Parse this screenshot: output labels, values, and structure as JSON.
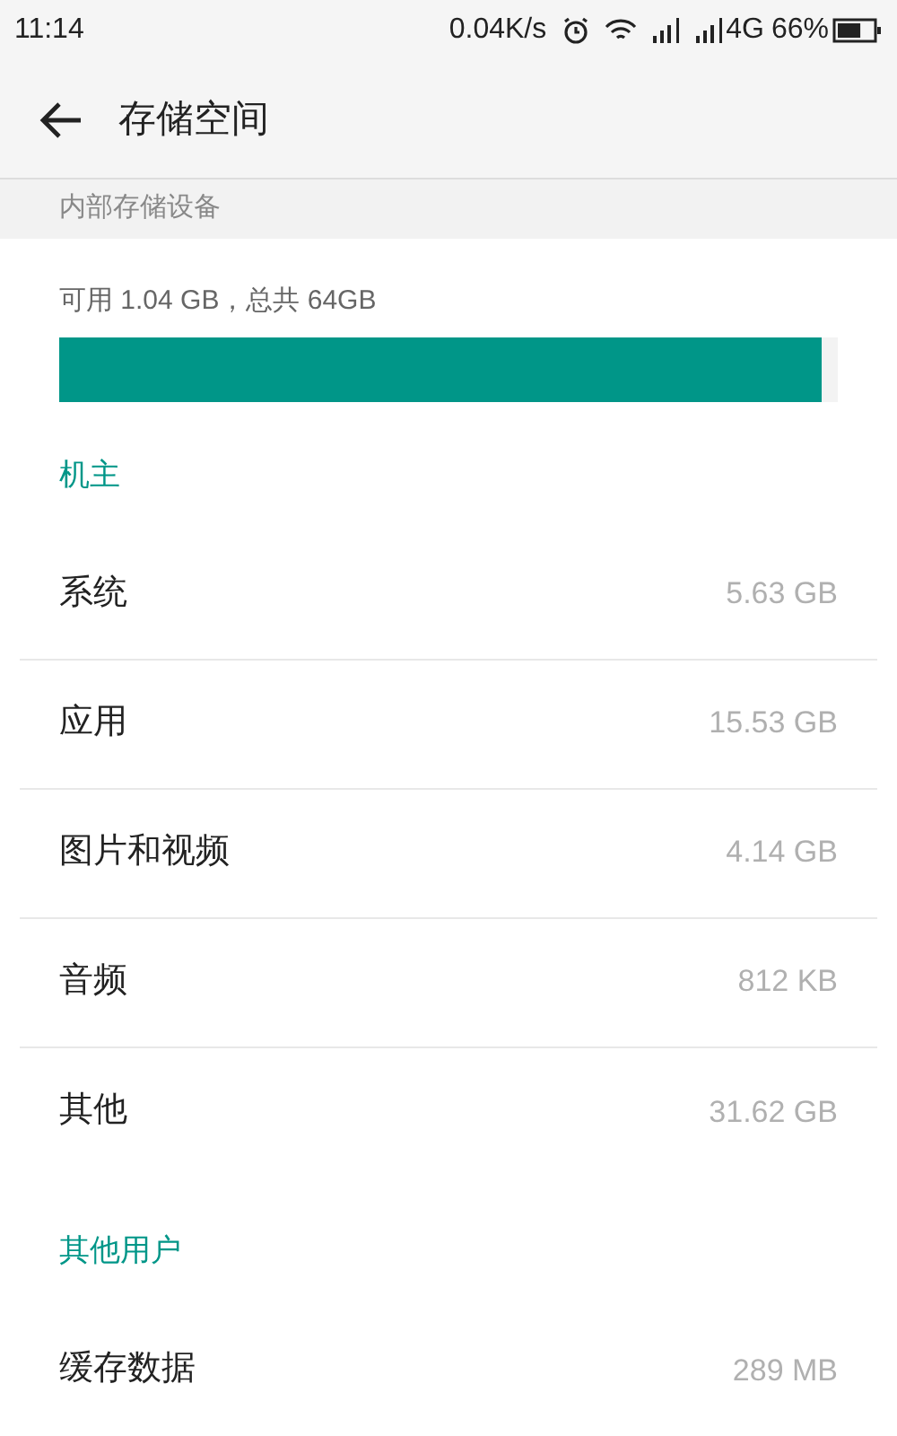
{
  "status_bar": {
    "time": "11:14",
    "speed": "0.04K/s",
    "network": "4G",
    "battery": "66%"
  },
  "app_bar": {
    "title": "存储空间"
  },
  "section_header": "内部存储设备",
  "storage": {
    "summary": "可用 1.04 GB，总共 64GB",
    "level": 0.98
  },
  "groups": [
    {
      "title": "机主",
      "items": [
        {
          "label": "系统",
          "value": "5.63 GB"
        },
        {
          "label": "应用",
          "value": "15.53 GB"
        },
        {
          "label": "图片和视频",
          "value": "4.14 GB"
        },
        {
          "label": "音频",
          "value": "812 KB"
        },
        {
          "label": "其他",
          "value": "31.62 GB"
        }
      ]
    },
    {
      "title": "其他用户",
      "items": [
        {
          "label": "缓存数据",
          "value": "289 MB"
        }
      ]
    }
  ]
}
